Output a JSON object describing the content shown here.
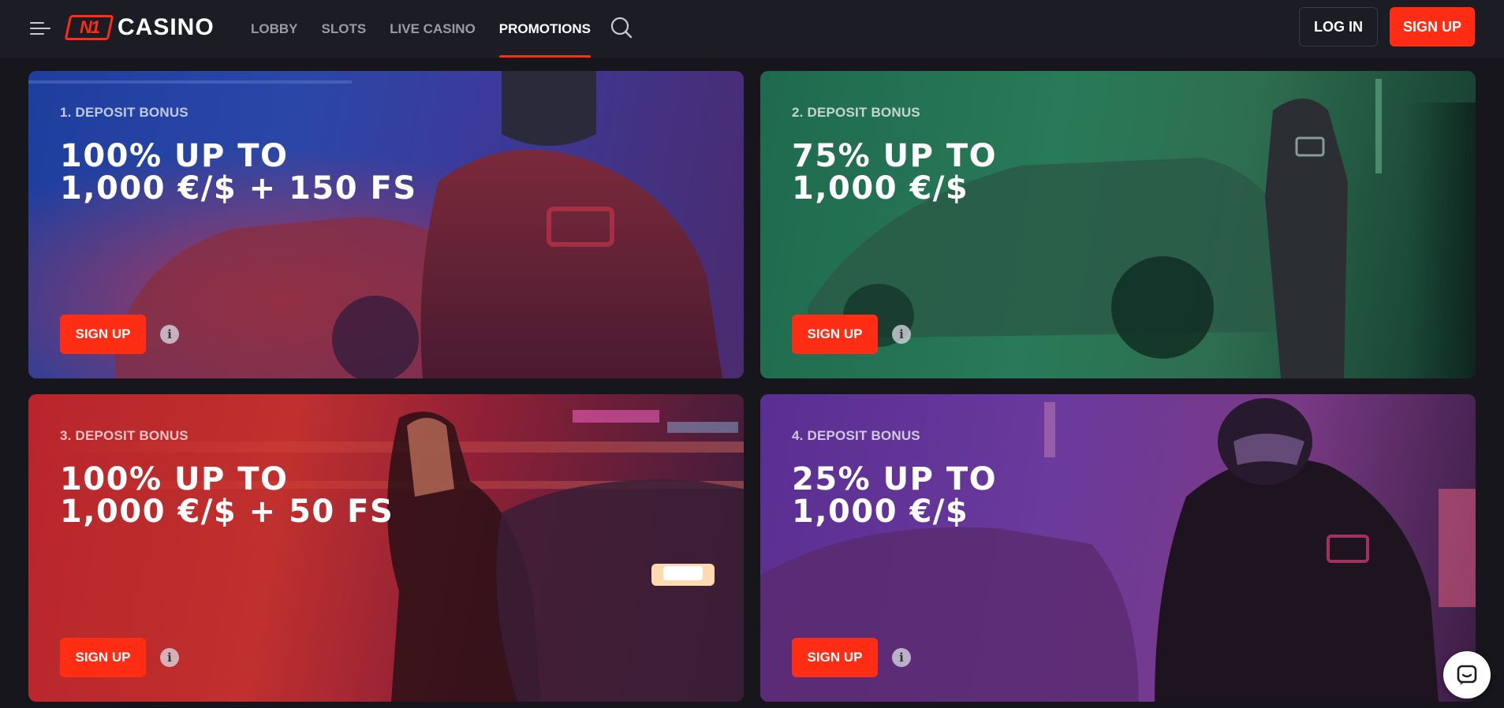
{
  "header": {
    "logo_mark": "N1",
    "logo_text": "CASINO",
    "nav": [
      {
        "label": "LOBBY",
        "active": false
      },
      {
        "label": "SLOTS",
        "active": false
      },
      {
        "label": "LIVE CASINO",
        "active": false
      },
      {
        "label": "PROMOTIONS",
        "active": true
      }
    ],
    "login_label": "LOG IN",
    "signup_label": "SIGN UP"
  },
  "promotions": [
    {
      "label": "1. DEPOSIT BONUS",
      "title_line1": "100% UP TO",
      "title_line2": "1,000 €/$ + 150 FS",
      "signup_label": "SIGN UP",
      "info_icon": "info-icon",
      "theme": "blue"
    },
    {
      "label": "2. DEPOSIT BONUS",
      "title_line1": "75% UP TO",
      "title_line2": "1,000 €/$",
      "signup_label": "SIGN UP",
      "info_icon": "info-icon",
      "theme": "green"
    },
    {
      "label": "3. DEPOSIT BONUS",
      "title_line1": "100% UP TO",
      "title_line2": "1,000 €/$ + 50 FS",
      "signup_label": "SIGN UP",
      "info_icon": "info-icon",
      "theme": "red"
    },
    {
      "label": "4. DEPOSIT BONUS",
      "title_line1": "25% UP TO",
      "title_line2": "1,000 €/$",
      "signup_label": "SIGN UP",
      "info_icon": "info-icon",
      "theme": "purple"
    }
  ],
  "colors": {
    "accent": "#ff2d14",
    "header_bg": "#1c1c24",
    "page_bg": "#16161c"
  },
  "icons": {
    "menu": "hamburger-menu-icon",
    "search": "search-icon",
    "chat": "chat-icon",
    "info": "info-icon"
  }
}
